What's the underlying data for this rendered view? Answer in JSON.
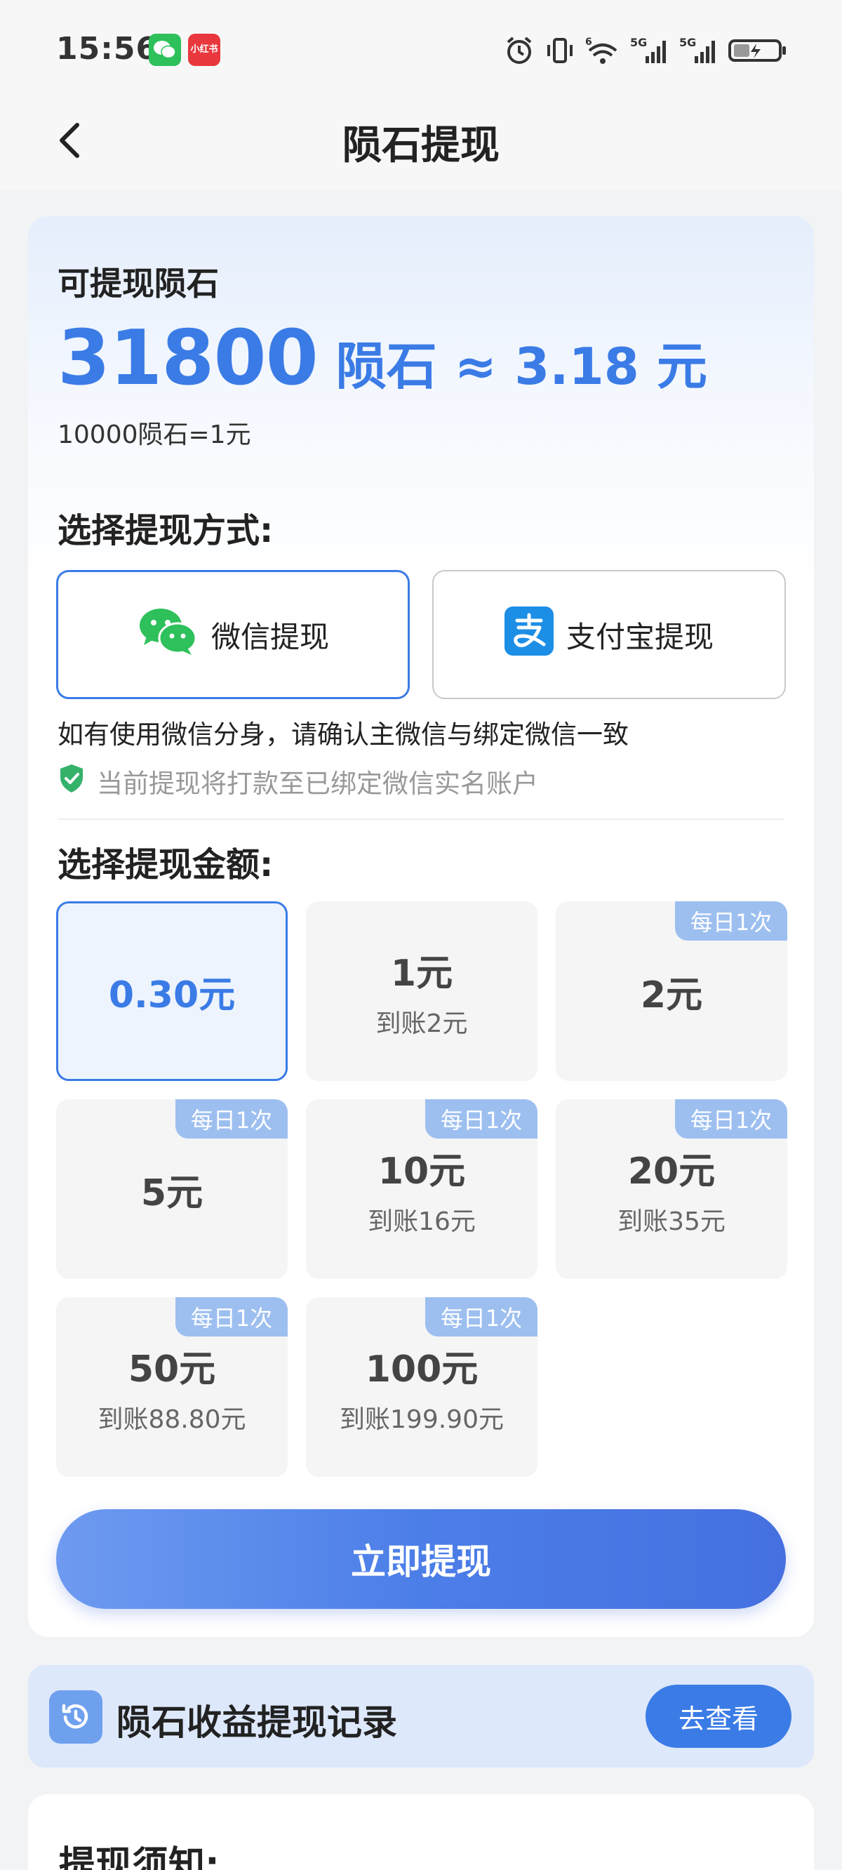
{
  "status_bar": {
    "time": "15:56",
    "wechat_icon": "wechat-app-icon",
    "xhs_badge": "小红书",
    "network_5g_1": "5G",
    "network_5g_2": "5G",
    "network_6": "6"
  },
  "header": {
    "title": "陨石提现",
    "back_icon": "chevron-left-icon"
  },
  "balance": {
    "label": "可提现陨石",
    "amount": "31800",
    "unit_text": "陨石 ≈ 3.18 元",
    "rate": "10000陨石=1元"
  },
  "method": {
    "title": "选择提现方式:",
    "options": [
      {
        "label": "微信提现",
        "icon": "wechat-icon",
        "selected": true
      },
      {
        "label": "支付宝提现",
        "icon": "alipay-icon",
        "selected": false
      }
    ],
    "notice": "如有使用微信分身，请确认主微信与绑定微信一致",
    "secure_notice": "当前提现将打款至已绑定微信实名账户"
  },
  "amount": {
    "title": "选择提现金额:",
    "options": [
      {
        "value": "0.30元",
        "sub": "",
        "tag": "",
        "selected": true
      },
      {
        "value": "1元",
        "sub": "到账2元",
        "tag": "",
        "selected": false
      },
      {
        "value": "2元",
        "sub": "",
        "tag": "每日1次",
        "selected": false
      },
      {
        "value": "5元",
        "sub": "",
        "tag": "每日1次",
        "selected": false
      },
      {
        "value": "10元",
        "sub": "到账16元",
        "tag": "每日1次",
        "selected": false
      },
      {
        "value": "20元",
        "sub": "到账35元",
        "tag": "每日1次",
        "selected": false
      },
      {
        "value": "50元",
        "sub": "到账88.80元",
        "tag": "每日1次",
        "selected": false
      },
      {
        "value": "100元",
        "sub": "到账199.90元",
        "tag": "每日1次",
        "selected": false
      }
    ]
  },
  "withdraw_button": "立即提现",
  "record": {
    "title": "陨石收益提现记录",
    "button": "去查看",
    "icon": "history-clock-icon"
  },
  "notice_card": {
    "title": "提现须知:"
  },
  "colors": {
    "accent": "#3a7be6",
    "tag": "#9dbff0",
    "wechat_green": "#2ec05a",
    "alipay_blue": "#1c8ee6"
  }
}
